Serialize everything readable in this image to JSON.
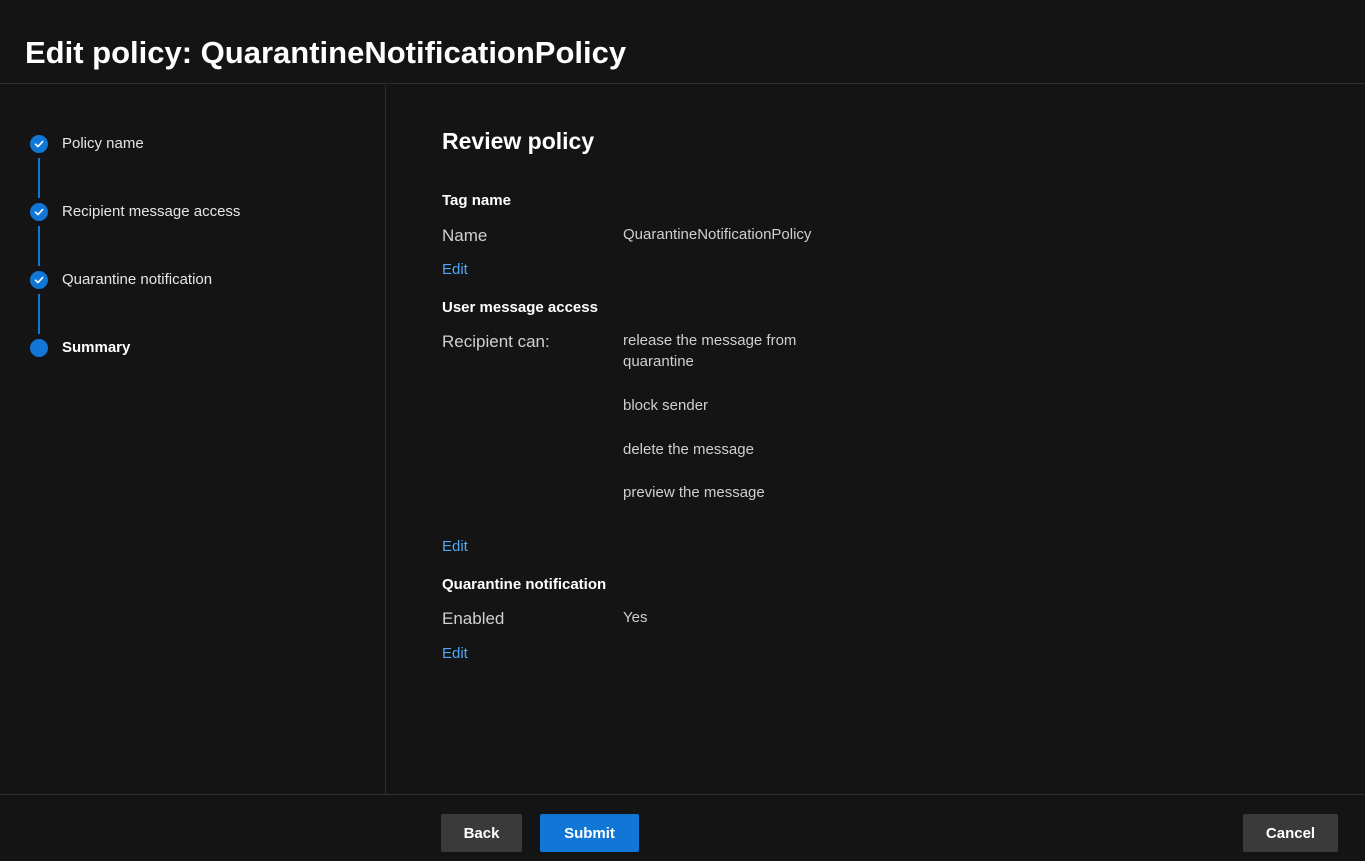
{
  "header": {
    "title": "Edit policy: QuarantineNotificationPolicy"
  },
  "steps": [
    {
      "label": "Policy name",
      "status": "completed",
      "icon": "checkmark-icon"
    },
    {
      "label": "Recipient message access",
      "status": "completed",
      "icon": "checkmark-icon"
    },
    {
      "label": "Quarantine notification",
      "status": "completed",
      "icon": "checkmark-icon"
    },
    {
      "label": "Summary",
      "status": "current",
      "icon": "current-step-dot"
    }
  ],
  "review": {
    "title": "Review policy",
    "tag_name": {
      "heading": "Tag name",
      "label": "Name",
      "value": "QuarantineNotificationPolicy",
      "edit_label": "Edit"
    },
    "user_message_access": {
      "heading": "User message access",
      "label": "Recipient can:",
      "values": [
        "release the message from",
        "quarantine",
        "block sender",
        "delete the message",
        "preview the message"
      ],
      "edit_label": "Edit"
    },
    "quarantine_notification": {
      "heading": "Quarantine notification",
      "label": "Enabled",
      "value": "Yes",
      "edit_label": "Edit"
    }
  },
  "footer": {
    "back_label": "Back",
    "submit_label": "Submit",
    "cancel_label": "Cancel"
  },
  "colors": {
    "accent": "#1177d6",
    "link": "#4ea6f5",
    "background": "#141414"
  }
}
